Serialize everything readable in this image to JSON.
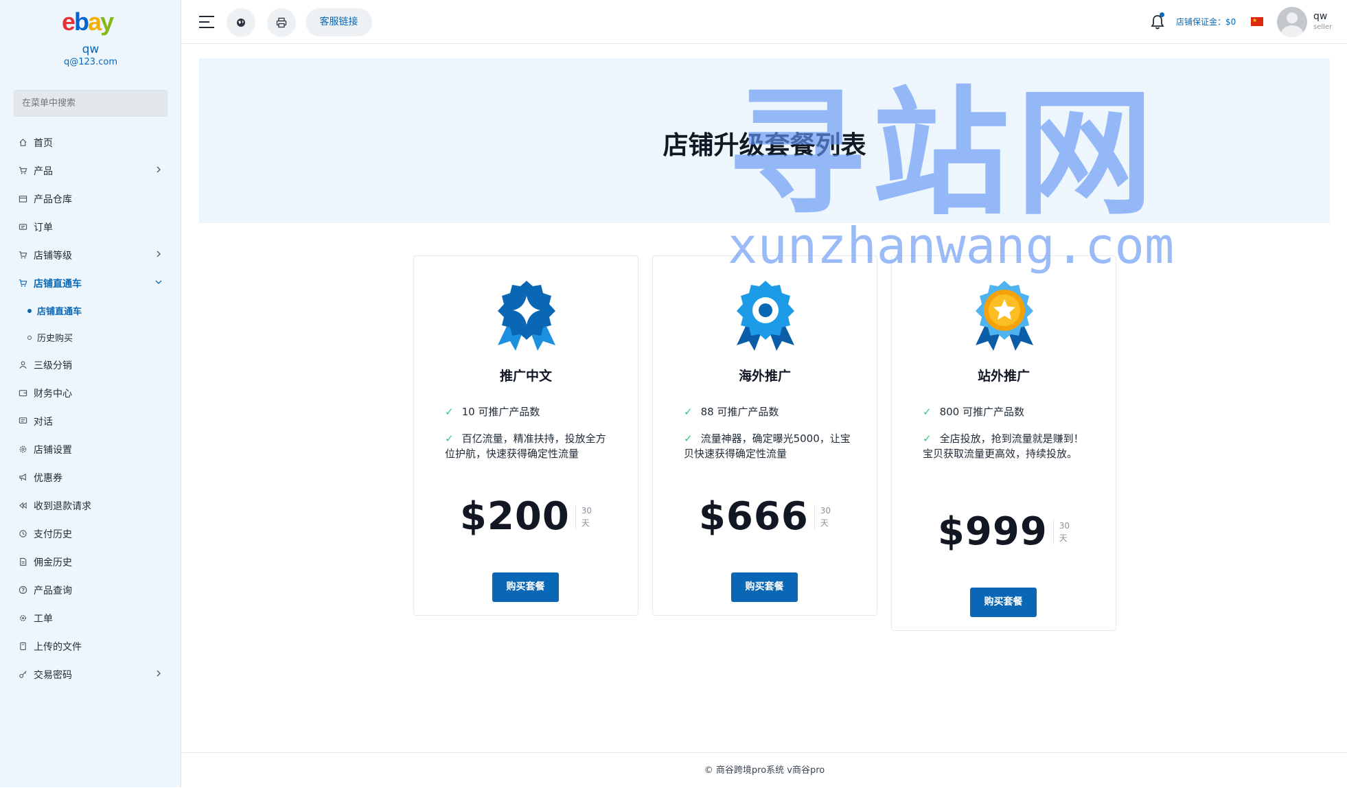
{
  "brand": {
    "logo": {
      "e": "e",
      "b": "b",
      "a": "a",
      "y": "y"
    },
    "colors": {
      "primary": "#0a67b5",
      "logo_e": "#e53238",
      "logo_b": "#0064d2",
      "logo_a": "#f5af02",
      "logo_y": "#86b817"
    }
  },
  "sidebar": {
    "user_name": "qw",
    "user_email": "q@123.com",
    "search_placeholder": "在菜单中搜索",
    "items": [
      {
        "label": "首页",
        "icon": "home-icon"
      },
      {
        "label": "产品",
        "icon": "cart-icon",
        "chevron": "right"
      },
      {
        "label": "产品仓库",
        "icon": "warehouse-icon"
      },
      {
        "label": "订单",
        "icon": "ticket-icon"
      },
      {
        "label": "店铺等级",
        "icon": "cart-icon",
        "chevron": "right"
      },
      {
        "label": "店铺直通车",
        "icon": "cart-icon",
        "chevron": "down",
        "active": true
      },
      {
        "label": "店铺直通车",
        "sub": true,
        "current": true
      },
      {
        "label": "历史购买",
        "sub": true
      },
      {
        "label": "三级分销",
        "icon": "user-icon"
      },
      {
        "label": "财务中心",
        "icon": "wallet-icon"
      },
      {
        "label": "对话",
        "icon": "chat-icon"
      },
      {
        "label": "店铺设置",
        "icon": "gear-icon"
      },
      {
        "label": "优惠券",
        "icon": "megaphone-icon"
      },
      {
        "label": "收到退款请求",
        "icon": "rewind-icon"
      },
      {
        "label": "支付历史",
        "icon": "history-icon"
      },
      {
        "label": "佣金历史",
        "icon": "document-icon"
      },
      {
        "label": "产品查询",
        "icon": "question-icon"
      },
      {
        "label": "工单",
        "icon": "cog-icon"
      },
      {
        "label": "上传的文件",
        "icon": "file-icon"
      },
      {
        "label": "交易密码",
        "icon": "key-icon",
        "chevron": "right"
      }
    ]
  },
  "topbar": {
    "service_link": "客服链接",
    "deposit": "店铺保证金：$0",
    "user_name": "qw",
    "user_role": "seller"
  },
  "hero": {
    "title": "店铺升级套餐列表"
  },
  "watermark": {
    "main": "寻站网",
    "sub": "xunzhanwang.com"
  },
  "plans": [
    {
      "name": "推广中文",
      "badge": "blue-diamond-badge-icon",
      "features": [
        "10 可推广产品数",
        "百亿流量，精准扶持，投放全方位护航，快速获得确定性流量"
      ],
      "price": "$200",
      "period_num": "30",
      "period_unit": "天",
      "button": "购买套餐"
    },
    {
      "name": "海外推广",
      "badge": "blue-ring-badge-icon",
      "features": [
        "88 可推广产品数",
        "流量神器，确定曝光5000，让宝贝快速获得确定性流量"
      ],
      "price": "$666",
      "period_num": "30",
      "period_unit": "天",
      "button": "购买套餐"
    },
    {
      "name": "站外推广",
      "badge": "gold-star-badge-icon",
      "features": [
        "800 可推广产品数",
        "全店投放，抢到流量就是赚到！宝贝获取流量更高效，持续投放。"
      ],
      "price": "$999",
      "period_num": "30",
      "period_unit": "天",
      "button": "购买套餐"
    }
  ],
  "footer": {
    "text": "© 商谷跨境pro系统 v商谷pro"
  }
}
